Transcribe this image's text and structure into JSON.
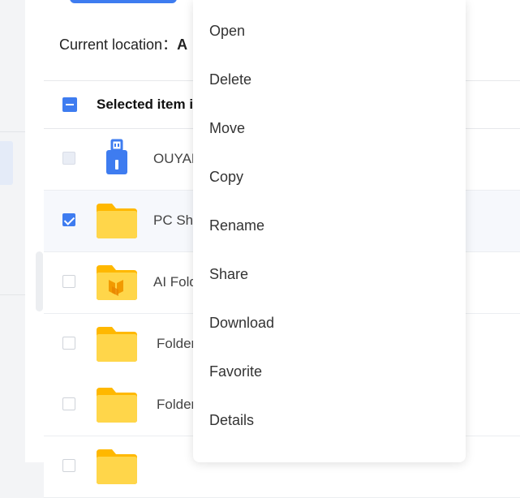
{
  "location": {
    "label": "Current location：",
    "value": "A"
  },
  "header": {
    "title": "Selected item i"
  },
  "rows": [
    {
      "name": "OUYAN",
      "icon": "usb-drive-icon",
      "checkbox": "disabled"
    },
    {
      "name": "PC Sha",
      "icon": "folder-icon",
      "checkbox": "checked"
    },
    {
      "name": "AI Fold",
      "icon": "ai-folder-icon",
      "checkbox": "unchecked"
    },
    {
      "name": "Folder",
      "icon": "folder-icon",
      "checkbox": "unchecked"
    },
    {
      "name": "Folder",
      "icon": "folder-icon",
      "checkbox": "unchecked"
    },
    {
      "name": "",
      "icon": "folder-icon",
      "checkbox": "unchecked"
    }
  ],
  "context_menu": {
    "items": [
      "Open",
      "Delete",
      "Move",
      "Copy",
      "Rename",
      "Share",
      "Download",
      "Favorite",
      "Details"
    ]
  },
  "colors": {
    "accent": "#3e7cf0",
    "folder": "#ffc928"
  }
}
